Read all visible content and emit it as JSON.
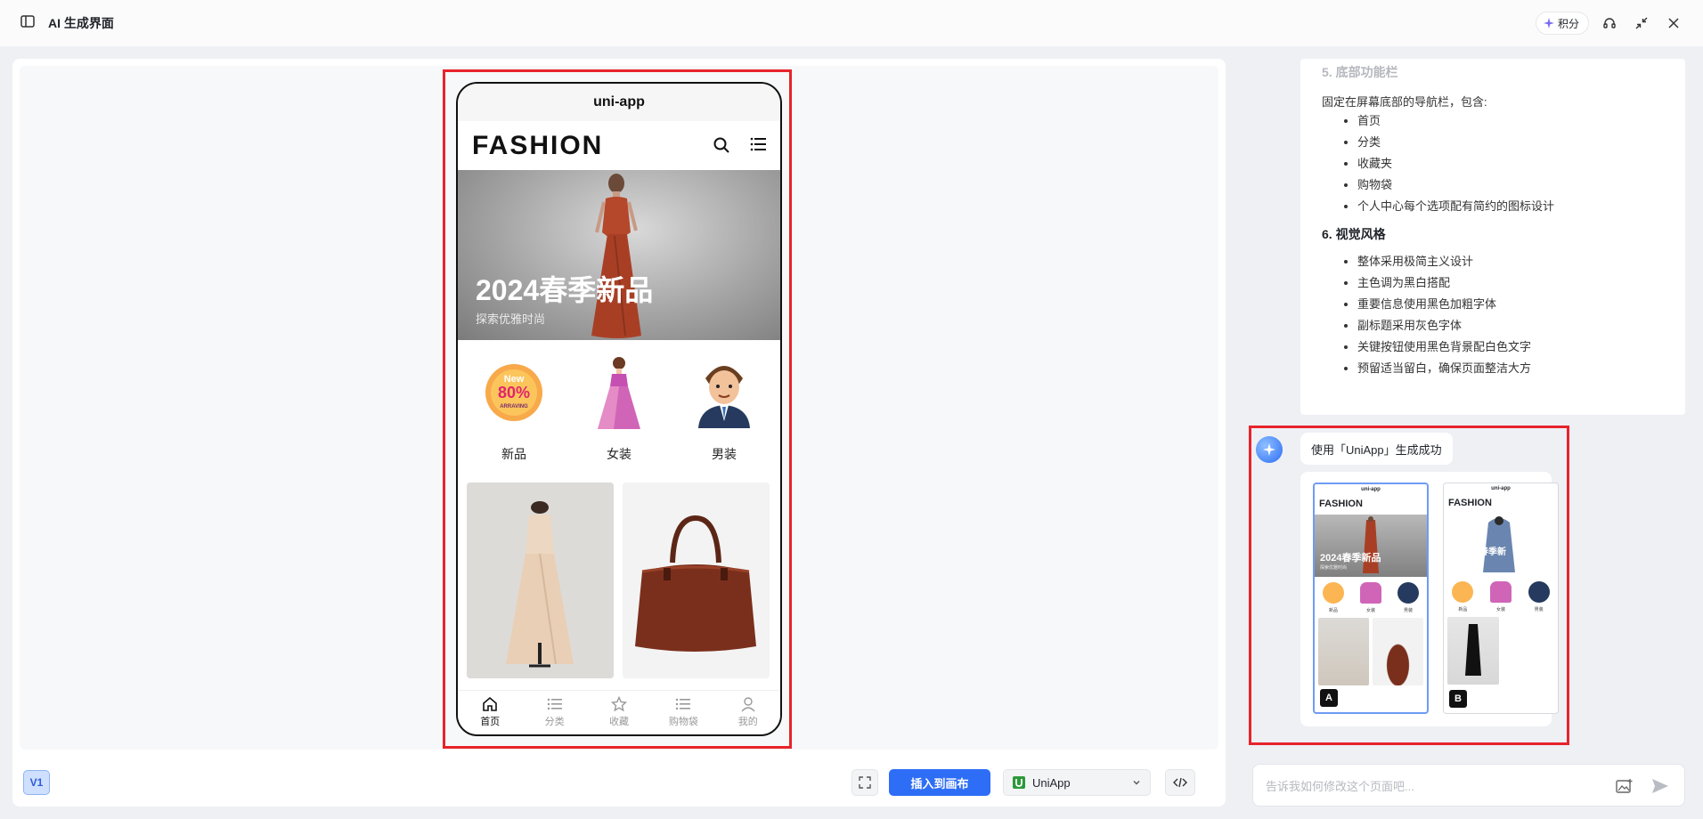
{
  "header": {
    "title": "AI 生成界面",
    "points_label": "积分"
  },
  "phone": {
    "status_title": "uni-app",
    "brand": "FASHION",
    "hero_title": "2024春季新品",
    "hero_subtitle": "探索优雅时尚",
    "categories": [
      {
        "label": "新品",
        "badge_new": "New",
        "badge_pct": "80%",
        "badge_sub": "ARRAVING"
      },
      {
        "label": "女装"
      },
      {
        "label": "男装"
      }
    ],
    "tabs": [
      {
        "label": "首页"
      },
      {
        "label": "分类"
      },
      {
        "label": "收藏"
      },
      {
        "label": "购物袋"
      },
      {
        "label": "我的"
      }
    ]
  },
  "toolbar": {
    "version": "V1",
    "insert_label": "插入到画布",
    "platform": "UniApp"
  },
  "chat": {
    "section5_title": "5. 底部功能栏",
    "section5_intro": "固定在屏幕底部的导航栏，包含:",
    "section5_items": [
      "首页",
      "分类",
      "收藏夹",
      "购物袋",
      "个人中心每个选项配有简约的图标设计"
    ],
    "section6_title": "6. 视觉风格",
    "section6_items": [
      "整体采用极简主义设计",
      "主色调为黑白搭配",
      "重要信息使用黑色加粗字体",
      "副标题采用灰色字体",
      "关键按钮使用黑色背景配白色文字",
      "预留适当留白，确保页面整洁大方"
    ],
    "success_message": "使用「UniApp」生成成功",
    "variants": [
      {
        "label": "A",
        "status": "uni-app",
        "brand": "FASHION",
        "hero": "2024春季新品",
        "hero_sub": "探索优雅时尚",
        "cats": [
          "新品",
          "女装",
          "男装"
        ]
      },
      {
        "label": "B",
        "status": "uni-app",
        "brand": "FASHION",
        "hero": "春季新",
        "cats": [
          "新品",
          "女装",
          "男装"
        ]
      }
    ],
    "input_placeholder": "告诉我如何修改这个页面吧..."
  },
  "colors": {
    "accent": "#2e6df6",
    "selection": "#e8232b"
  }
}
